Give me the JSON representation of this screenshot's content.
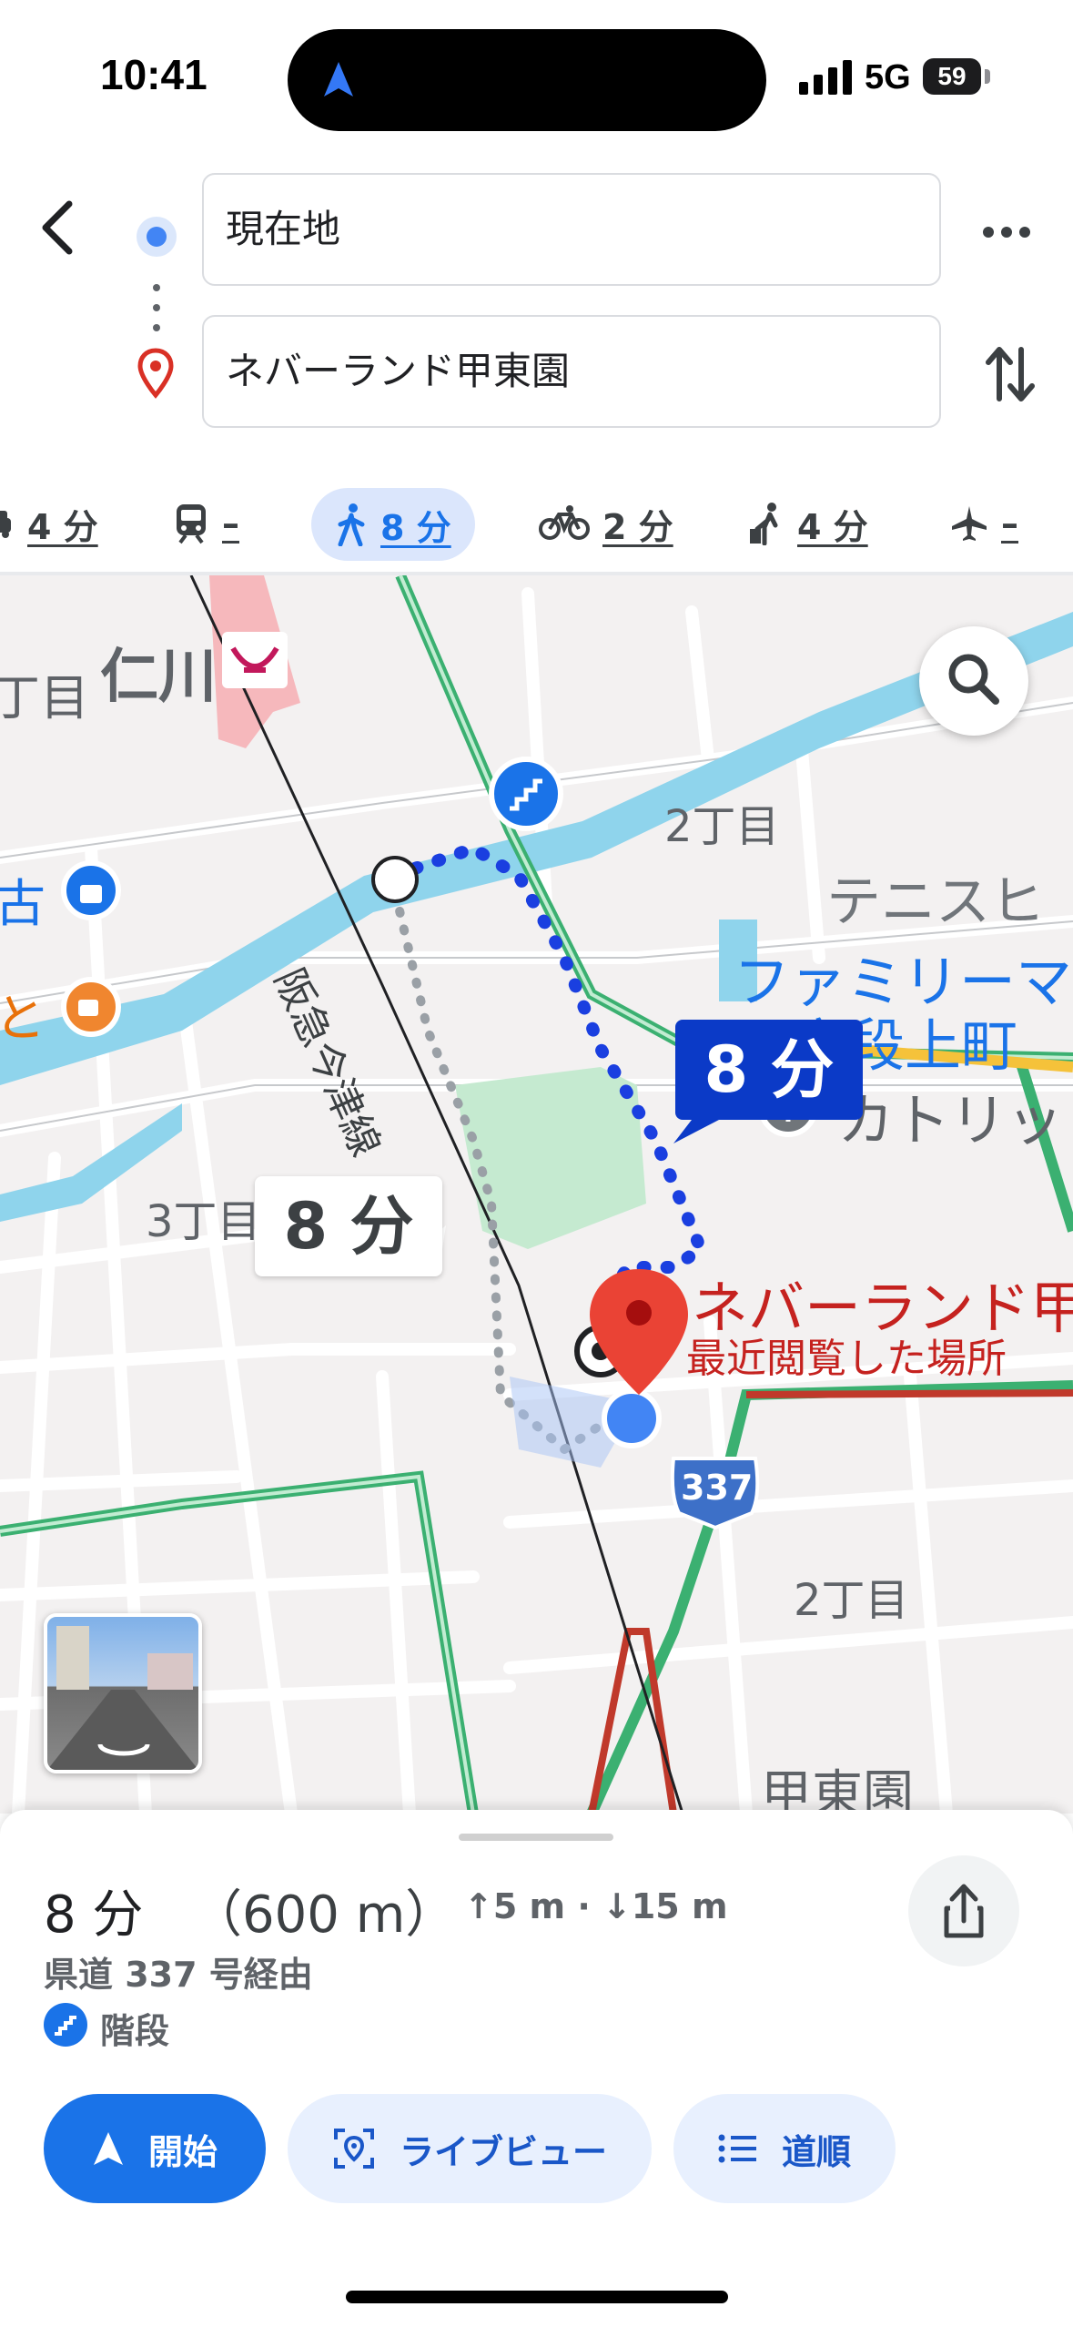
{
  "status": {
    "time": "10:41",
    "network": "5G",
    "battery": "59"
  },
  "route": {
    "origin": "現在地",
    "destination": "ネバーランド甲東園"
  },
  "modes": [
    {
      "name": "car",
      "label": "4 分"
    },
    {
      "name": "transit",
      "label": "–"
    },
    {
      "name": "walk",
      "label": "8 分",
      "active": true
    },
    {
      "name": "bike",
      "label": "2 分"
    },
    {
      "name": "ride",
      "label": "4 分"
    },
    {
      "name": "flight",
      "label": "–"
    }
  ],
  "map": {
    "labels": {
      "ninagawa": "仁川",
      "chome_left": "丁目",
      "nichome_top": "2丁目",
      "tennis": "テニスヒ",
      "family": "ファミリーマ",
      "family2": "宮段上町",
      "catholic": "カトリッ",
      "sanchome": "3丁目",
      "line": "阪急今津線",
      "dest_name": "ネバーランド甲",
      "dest_sub": "最近閲覧した場所",
      "route_no": "337",
      "nichome_bottom": "2丁目",
      "kotoen": "甲東園",
      "shop_left": "古",
      "cafe_left": "と"
    },
    "bubble_selected": "8 分",
    "bubble_alt": "8 分"
  },
  "summary": {
    "duration": "8 分",
    "distance": "（600 m）",
    "elevation": "↑5 m · ↓15 m",
    "via": "県道 337 号経由",
    "note": "階段"
  },
  "actions": {
    "start": "開始",
    "live_view": "ライブビュー",
    "steps": "道順"
  }
}
